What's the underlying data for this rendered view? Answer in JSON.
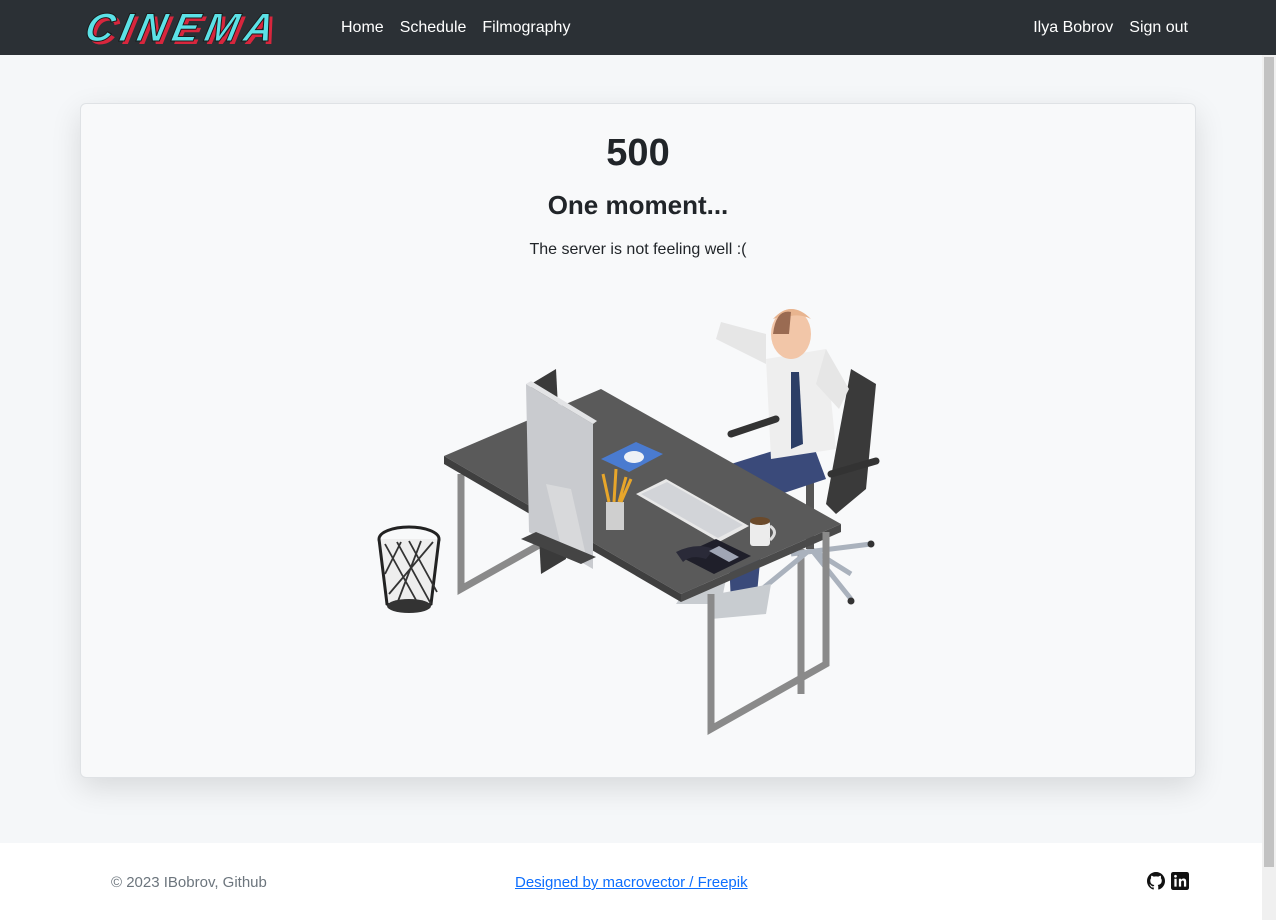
{
  "navbar": {
    "brand": "CINEMA",
    "links": [
      "Home",
      "Schedule",
      "Filmography"
    ],
    "user_name": "Ilya Bobrov",
    "sign_out": "Sign out"
  },
  "error": {
    "code": "500",
    "title": "One moment...",
    "message": "The server is not feeling well :("
  },
  "footer": {
    "copyright": "© 2023 IBobrov, Github",
    "credit": "Designed by macrovector / Freepik",
    "social_icons": [
      "github-icon",
      "linkedin-icon"
    ]
  },
  "colors": {
    "navbar": "#2b3035",
    "brand_fill": "#5ce1e6",
    "brand_shadow": "#e63946",
    "link": "#0d6efd",
    "page_bg": "#f5f7f9"
  }
}
